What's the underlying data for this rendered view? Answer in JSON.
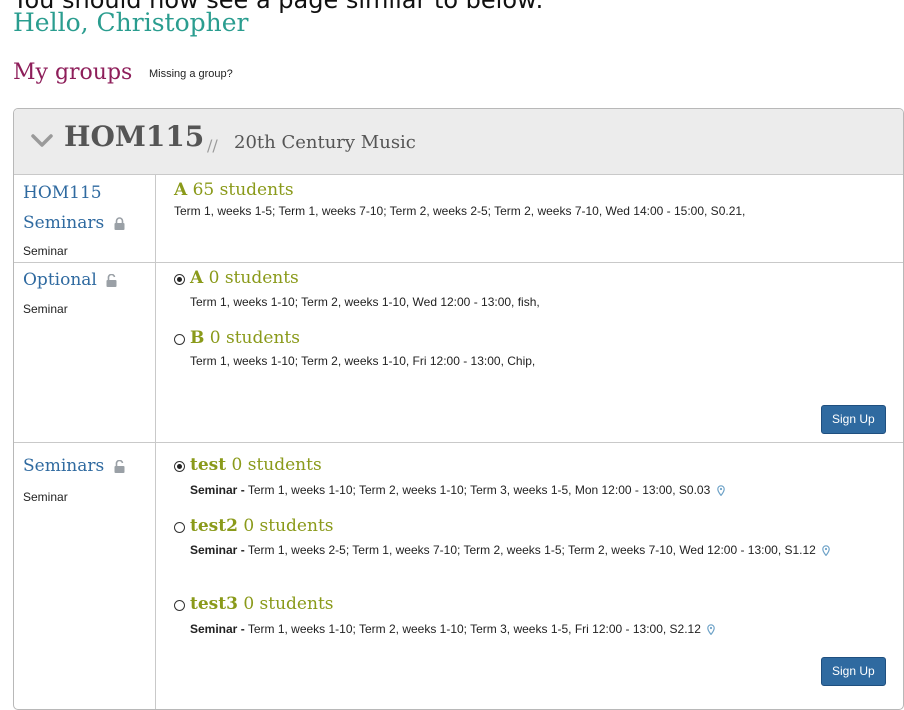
{
  "doc_note": "You should now see a page similar to below:",
  "greeting": "Hello, Christopher",
  "section_title": "My groups",
  "missing_link": "Missing a group?",
  "module": {
    "code": "HOM115",
    "separator": "//",
    "name": "20th Century Music"
  },
  "sets": [
    {
      "title_line1": "HOM115",
      "title_line2": "Seminars",
      "lock_icon": "lock-closed-icon",
      "type": "Seminar",
      "groups": [
        {
          "name": "A",
          "count": "65 students",
          "detail": "Term 1, weeks 1-5; Term 1, weeks 7-10; Term 2, weeks 2-5; Term 2, weeks 7-10, Wed 14:00 - 15:00, S0.21,"
        }
      ]
    },
    {
      "title": "Optional",
      "lock_icon": "lock-open-icon",
      "type": "Seminar",
      "groups": [
        {
          "name": "A",
          "count": "0 students",
          "selected": true,
          "detail": "Term 1, weeks 1-10; Term 2, weeks 1-10, Wed 12:00 - 13:00, fish,"
        },
        {
          "name": "B",
          "count": "0 students",
          "selected": false,
          "detail": "Term 1, weeks 1-10; Term 2, weeks 1-10, Fri 12:00 - 13:00, Chip,"
        }
      ],
      "button": "Sign Up"
    },
    {
      "title": "Seminars",
      "lock_icon": "lock-open-icon",
      "type": "Seminar",
      "groups": [
        {
          "name": "test",
          "count": "0 students",
          "selected": true,
          "label": "Seminar -",
          "detail": "Term 1, weeks 1-10; Term 2, weeks 1-10; Term 3, weeks 1-5, Mon 12:00 - 13:00, S0.03"
        },
        {
          "name": "test2",
          "count": "0 students",
          "selected": false,
          "label": "Seminar -",
          "detail": "Term 1, weeks 2-5; Term 1, weeks 7-10; Term 2, weeks 1-5; Term 2, weeks 7-10, Wed 12:00 - 13:00, S1.12"
        },
        {
          "name": "test3",
          "count": "0 students",
          "selected": false,
          "label": "Seminar -",
          "detail": "Term 1, weeks 1-10; Term 2, weeks 1-10; Term 3, weeks 1-5, Fri 12:00 - 13:00, S2.12"
        }
      ],
      "button": "Sign Up"
    }
  ],
  "colors": {
    "greeting": "#2a9d8f",
    "section_title": "#8e1e5a",
    "set_title": "#2f6aa0",
    "group_name": "#8a9a1a",
    "button": "#2f6aa0"
  }
}
